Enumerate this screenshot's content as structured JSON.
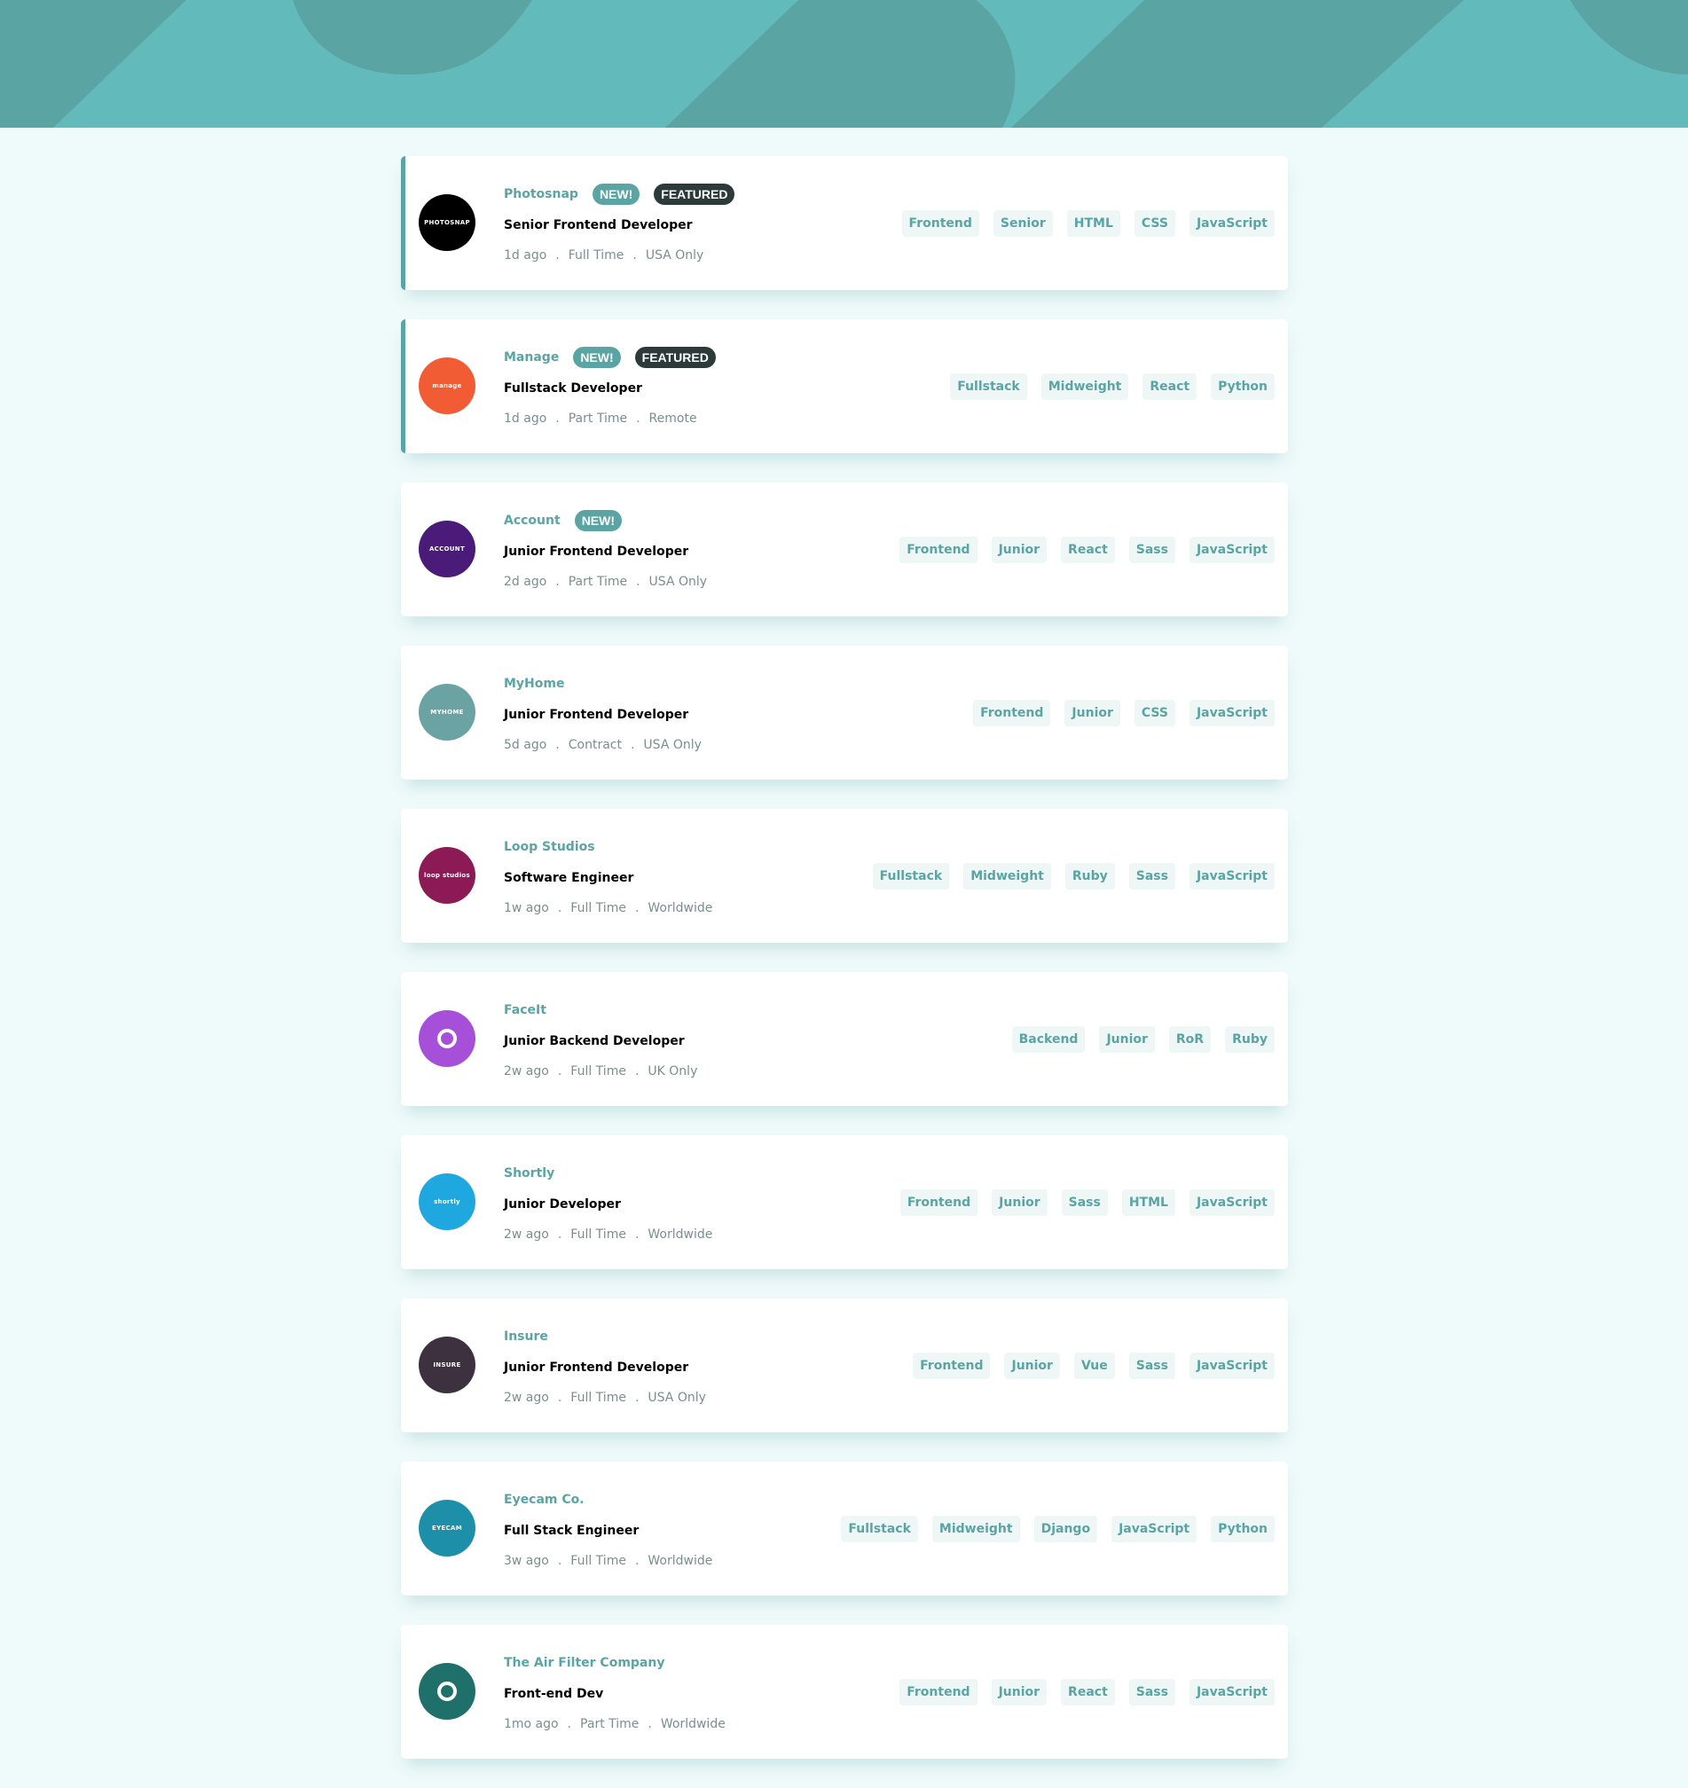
{
  "colors": {
    "primary": "#5ba4a4",
    "background": "#effafa",
    "tag_bg": "#eef6f6",
    "dark": "#2c3a3a"
  },
  "jobs": [
    {
      "company": "Photosnap",
      "logo_text": "PHOTOSNAP",
      "logo_color": "#000000",
      "new": "NEW!",
      "featured": "FEATURED",
      "position": "Senior Frontend Developer",
      "posted": "1d ago",
      "contract": "Full Time",
      "location": "USA Only",
      "tags": [
        "Frontend",
        "Senior",
        "HTML",
        "CSS",
        "JavaScript"
      ]
    },
    {
      "company": "Manage",
      "logo_text": "manage",
      "logo_color": "#f25c34",
      "new": "NEW!",
      "featured": "FEATURED",
      "position": "Fullstack Developer",
      "posted": "1d ago",
      "contract": "Part Time",
      "location": "Remote",
      "tags": [
        "Fullstack",
        "Midweight",
        "React",
        "Python"
      ]
    },
    {
      "company": "Account",
      "logo_text": "ACCOUNT",
      "logo_color": "#4a1b78",
      "new": "NEW!",
      "position": "Junior Frontend Developer",
      "posted": "2d ago",
      "contract": "Part Time",
      "location": "USA Only",
      "tags": [
        "Frontend",
        "Junior",
        "React",
        "Sass",
        "JavaScript"
      ]
    },
    {
      "company": "MyHome",
      "logo_text": "MYHOME",
      "logo_color": "#6ba3a3",
      "position": "Junior Frontend Developer",
      "posted": "5d ago",
      "contract": "Contract",
      "location": "USA Only",
      "tags": [
        "Frontend",
        "Junior",
        "CSS",
        "JavaScript"
      ]
    },
    {
      "company": "Loop Studios",
      "logo_text": "loop studios",
      "logo_color": "#8b1a55",
      "position": "Software Engineer",
      "posted": "1w ago",
      "contract": "Full Time",
      "location": "Worldwide",
      "tags": [
        "Fullstack",
        "Midweight",
        "Ruby",
        "Sass",
        "JavaScript"
      ]
    },
    {
      "company": "FaceIt",
      "logo_text": "",
      "logo_color": "#a64fd8",
      "position": "Junior Backend Developer",
      "posted": "2w ago",
      "contract": "Full Time",
      "location": "UK Only",
      "tags": [
        "Backend",
        "Junior",
        "RoR",
        "Ruby"
      ]
    },
    {
      "company": "Shortly",
      "logo_text": "shortly",
      "logo_color": "#1ea8df",
      "position": "Junior Developer",
      "posted": "2w ago",
      "contract": "Full Time",
      "location": "Worldwide",
      "tags": [
        "Frontend",
        "Junior",
        "Sass",
        "HTML",
        "JavaScript"
      ]
    },
    {
      "company": "Insure",
      "logo_text": "INSURE",
      "logo_color": "#3d3140",
      "position": "Junior Frontend Developer",
      "posted": "2w ago",
      "contract": "Full Time",
      "location": "USA Only",
      "tags": [
        "Frontend",
        "Junior",
        "Vue",
        "Sass",
        "JavaScript"
      ]
    },
    {
      "company": "Eyecam Co.",
      "logo_text": "EYECAM",
      "logo_color": "#1d8fa8",
      "position": "Full Stack Engineer",
      "posted": "3w ago",
      "contract": "Full Time",
      "location": "Worldwide",
      "tags": [
        "Fullstack",
        "Midweight",
        "Django",
        "JavaScript",
        "Python"
      ]
    },
    {
      "company": "The Air Filter Company",
      "logo_text": "",
      "logo_color": "#1f6f6b",
      "position": "Front-end Dev",
      "posted": "1mo ago",
      "contract": "Part Time",
      "location": "Worldwide",
      "tags": [
        "Frontend",
        "Junior",
        "React",
        "Sass",
        "JavaScript"
      ]
    }
  ]
}
